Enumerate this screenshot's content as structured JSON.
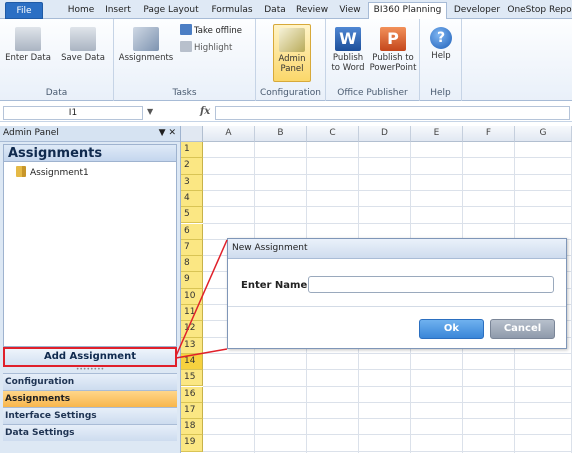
{
  "ribbon_tabs": [
    {
      "label": "File"
    },
    {
      "label": "Home"
    },
    {
      "label": "Insert"
    },
    {
      "label": "Page Layout"
    },
    {
      "label": "Formulas"
    },
    {
      "label": "Data"
    },
    {
      "label": "Review"
    },
    {
      "label": "View"
    },
    {
      "label": "BI360 Planning"
    },
    {
      "label": "Developer"
    },
    {
      "label": "OneStop Repo"
    }
  ],
  "ribbon": {
    "data_group": {
      "label": "Data",
      "enter_data": "Enter Data",
      "save_data": "Save Data"
    },
    "tasks_group": {
      "label": "Tasks",
      "assignments": "Assignments",
      "take_offline": "Take offline",
      "highlight": "Highlight"
    },
    "config_group": {
      "label": "Configuration",
      "admin_panel_line1": "Admin",
      "admin_panel_line2": "Panel"
    },
    "office_group": {
      "label": "Office Publisher",
      "publish_word_line1": "Publish",
      "publish_word_line2": "to Word",
      "publish_ppt_line1": "Publish to",
      "publish_ppt_line2": "PowerPoint"
    },
    "help_group": {
      "label": "Help",
      "help": "Help"
    }
  },
  "formula_bar": {
    "name_box": "I1",
    "fx": "fx"
  },
  "admin_panel": {
    "title": "Admin Panel",
    "controls": "▼ ✕",
    "section_title": "Assignments",
    "items": [
      {
        "label": "Assignment1"
      }
    ],
    "add_button": "Add Assignment",
    "nav": [
      {
        "label": "Configuration"
      },
      {
        "label": "Assignments"
      },
      {
        "label": "Interface Settings"
      },
      {
        "label": "Data Settings"
      }
    ]
  },
  "grid": {
    "columns": [
      "A",
      "B",
      "C",
      "D",
      "E",
      "F",
      "G"
    ],
    "rows": [
      "1",
      "2",
      "3",
      "4",
      "5",
      "6",
      "7",
      "8",
      "9",
      "10",
      "11",
      "12",
      "13",
      "14",
      "15",
      "16",
      "17",
      "18",
      "19"
    ]
  },
  "dialog": {
    "title": "New Assignment",
    "name_label": "Enter Name:",
    "name_value": "",
    "ok": "Ok",
    "cancel": "Cancel"
  },
  "colors": {
    "callout": "#e0202a",
    "active_nav": "#f8b64c",
    "row_header": "#fbe783"
  }
}
